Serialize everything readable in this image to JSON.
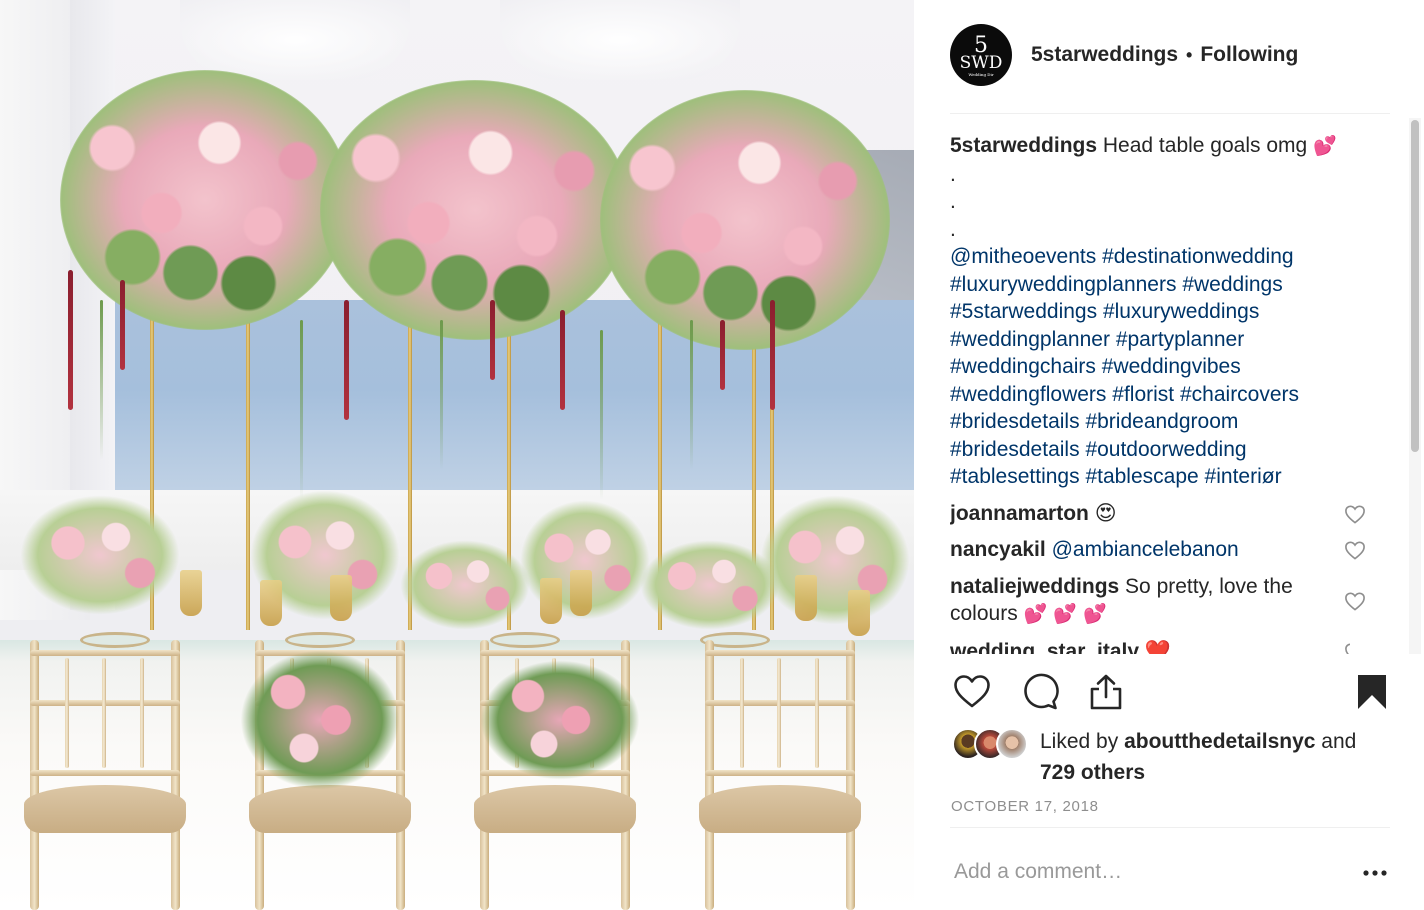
{
  "header": {
    "avatar_main": "5",
    "avatar_letters": "SWD",
    "avatar_sub": "Wedding Dir",
    "username": "5starweddings",
    "separator": "•",
    "follow_status": "Following"
  },
  "caption": {
    "username": "5starweddings",
    "text": "Head table goals omg",
    "emoji": "💕",
    "dots": [
      ".",
      ".",
      "."
    ],
    "tags": [
      [
        "@mitheoevents",
        "#destinationwedding"
      ],
      [
        "#luxuryweddingplanners",
        "#weddings"
      ],
      [
        "#5starweddings",
        "#luxuryweddings"
      ],
      [
        "#weddingplanner",
        "#partyplanner"
      ],
      [
        "#weddingchairs",
        "#weddingvibes"
      ],
      [
        "#weddingflowers",
        "#florist",
        "#chaircovers"
      ],
      [
        "#bridesdetails",
        "#brideandgroom"
      ],
      [
        "#bridesdetails",
        "#outdoorwedding"
      ],
      [
        "#tablesettings",
        "#tablescape",
        "#interiør"
      ]
    ]
  },
  "comments": [
    {
      "username": "joannamarton",
      "text": "",
      "emoji": "😍"
    },
    {
      "username": "nancyakil",
      "text": "",
      "mention": "@ambiancelebanon"
    },
    {
      "username": "nataliejweddings",
      "text": "So pretty, love the colours",
      "emoji": "💕 💕 💕"
    },
    {
      "username": "wedding_star_italy",
      "text": "",
      "emoji": "❤️"
    }
  ],
  "likes": {
    "prefix": "Liked by",
    "user": "aboutthedetailsnyc",
    "conj": "and",
    "others": "729 others"
  },
  "date": "OCTOBER 17, 2018",
  "add_comment": {
    "placeholder": "Add a comment…"
  },
  "more_label": "•••",
  "colors": {
    "hashtag": "#003569",
    "text": "#262626",
    "muted": "#8e8e8e",
    "divider": "#efefef"
  }
}
